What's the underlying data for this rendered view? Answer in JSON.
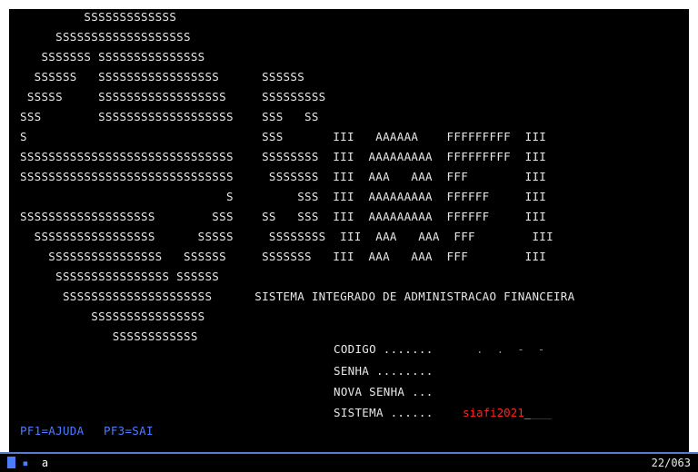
{
  "banner": {
    "lines": [
      "         SSSSSSSSSSSSS",
      "     SSSSSSSSSSSSSSSSSSS",
      "   SSSSSSS SSSSSSSSSSSSSSS",
      "  SSSSSS   SSSSSSSSSSSSSSSSS      SSSSSS",
      " SSSSS     SSSSSSSSSSSSSSSSSS     SSSSSSSSS",
      "SSS        SSSSSSSSSSSSSSSSSSS    SSS   SS",
      "S                                 SSS       III   AAAAAA    FFFFFFFFF  III",
      "SSSSSSSSSSSSSSSSSSSSSSSSSSSSSS    SSSSSSSS  III  AAAAAAAAA  FFFFFFFFF  III",
      "SSSSSSSSSSSSSSSSSSSSSSSSSSSSSS     SSSSSSS  III  AAA   AAA  FFF        III",
      "                             S         SSS  III  AAAAAAAAA  FFFFFF     III",
      "SSSSSSSSSSSSSSSSSSS        SSS    SS   SSS  III  AAAAAAAAA  FFFFFF     III",
      "  SSSSSSSSSSSSSSSSS      SSSSS     SSSSSSSS  III  AAA   AAA  FFF        III",
      "    SSSSSSSSSSSSSSSS   SSSSSS     SSSSSSS   III  AAA   AAA  FFF        III",
      "     SSSSSSSSSSSSSSSS SSSSSS",
      "      SSSSSSSSSSSSSSSSSSSSS      SISTEMA INTEGRADO DE ADMINISTRACAO FINANCEIRA",
      "          SSSSSSSSSSSSSSSS",
      "             SSSSSSSSSSSS"
    ]
  },
  "login": {
    "codigo_label": "CODIGO .......",
    "codigo_value": "  .  .  -  -",
    "senha_label": "SENHA ........",
    "nova_senha_label": "NOVA SENHA ...",
    "sistema_label": "SISTEMA ......",
    "sistema_value": "siafi2021",
    "sistema_fill": "___"
  },
  "function_keys": {
    "pf1": "PF1=AJUDA",
    "pf3": "PF3=SAI"
  },
  "status_bar": {
    "left_text": "a",
    "right_text": "22/063"
  },
  "colors": {
    "background": "#000000",
    "text": "#e8e8e8",
    "function_keys": "#4d7dff",
    "input_value": "#ff2222"
  }
}
